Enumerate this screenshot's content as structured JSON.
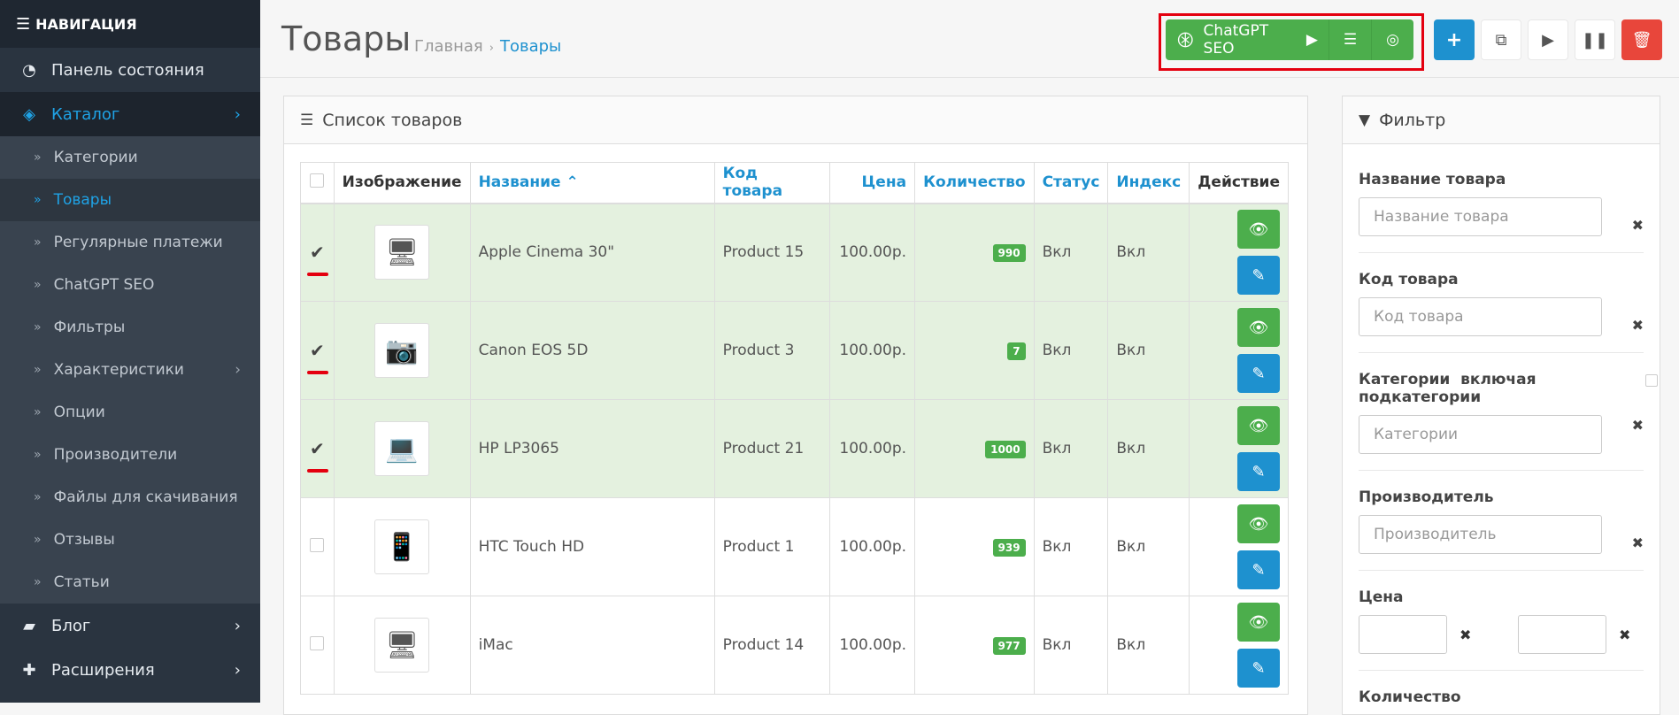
{
  "nav": {
    "title": "НАВИГАЦИЯ",
    "items": [
      {
        "label": "Панель состояния"
      },
      {
        "label": "Каталог"
      }
    ],
    "sub": [
      {
        "label": "Категории"
      },
      {
        "label": "Товары"
      },
      {
        "label": "Регулярные платежи"
      },
      {
        "label": "ChatGPT SEO"
      },
      {
        "label": "Фильтры"
      },
      {
        "label": "Характеристики"
      },
      {
        "label": "Опции"
      },
      {
        "label": "Производители"
      },
      {
        "label": "Файлы для скачивания"
      },
      {
        "label": "Отзывы"
      },
      {
        "label": "Статьи"
      }
    ],
    "bottom": [
      {
        "label": "Блог"
      },
      {
        "label": "Расширения"
      }
    ]
  },
  "header": {
    "title": "Товары",
    "breadcrumb_home": "Главная",
    "breadcrumb_current": "Товары",
    "seo_label": "ChatGPT SEO"
  },
  "list": {
    "title": "Список товаров",
    "columns": {
      "image": "Изображение",
      "name": "Название",
      "model": "Код товара",
      "price": "Цена",
      "quantity": "Количество",
      "status": "Статус",
      "index": "Индекс",
      "action": "Действие"
    },
    "rows": [
      {
        "name": "Apple Cinema 30\"",
        "model": "Product 15",
        "price": "100.00р.",
        "quantity": "990",
        "status": "Вкл",
        "index": "Вкл",
        "selected": true,
        "icon": "monitor"
      },
      {
        "name": "Canon EOS 5D",
        "model": "Product 3",
        "price": "100.00р.",
        "quantity": "7",
        "status": "Вкл",
        "index": "Вкл",
        "selected": true,
        "icon": "camera"
      },
      {
        "name": "HP LP3065",
        "model": "Product 21",
        "price": "100.00р.",
        "quantity": "1000",
        "status": "Вкл",
        "index": "Вкл",
        "selected": true,
        "icon": "laptop"
      },
      {
        "name": "HTC Touch HD",
        "model": "Product 1",
        "price": "100.00р.",
        "quantity": "939",
        "status": "Вкл",
        "index": "Вкл",
        "selected": false,
        "icon": "phone"
      },
      {
        "name": "iMac",
        "model": "Product 14",
        "price": "100.00р.",
        "quantity": "977",
        "status": "Вкл",
        "index": "Вкл",
        "selected": false,
        "icon": "desktop"
      }
    ]
  },
  "filter": {
    "title": "Фильтр",
    "name_label": "Название товара",
    "name_placeholder": "Название товара",
    "model_label": "Код товара",
    "model_placeholder": "Код товара",
    "cat_label": "Категории",
    "cat_sub_label": "включая подкатегории",
    "cat_placeholder": "Категории",
    "manuf_label": "Производитель",
    "manuf_placeholder": "Производитель",
    "price_label": "Цена",
    "qty_label": "Количество"
  }
}
